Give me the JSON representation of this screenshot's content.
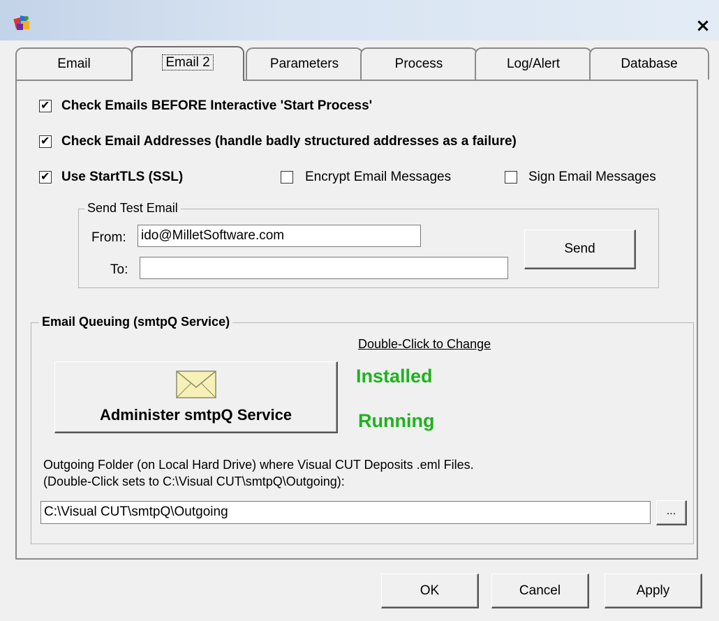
{
  "window": {
    "close_label": "×"
  },
  "tabs": [
    {
      "label": "Email"
    },
    {
      "label": "Email 2"
    },
    {
      "label": "Parameters"
    },
    {
      "label": "Process"
    },
    {
      "label": "Log/Alert"
    },
    {
      "label": "Database"
    }
  ],
  "active_tab": "Email 2",
  "options": {
    "check_before_start": {
      "label": "Check Emails BEFORE Interactive 'Start Process'",
      "checked": true
    },
    "check_addresses": {
      "label": "Check Email Addresses (handle badly structured addresses as a failure)",
      "checked": true
    },
    "use_starttls": {
      "label": "Use StartTLS (SSL)",
      "checked": true
    },
    "encrypt_messages": {
      "label": "Encrypt Email Messages",
      "checked": false
    },
    "sign_messages": {
      "label": "Sign Email Messages",
      "checked": false
    }
  },
  "test_email": {
    "group_title": "Send Test Email",
    "from_label": "From:",
    "from_value": "ido@MilletSoftware.com",
    "to_label": "To:",
    "to_value": "",
    "send_label": "Send"
  },
  "queuing": {
    "group_title": "Email Queuing (smtpQ Service)",
    "change_hint": "Double-Click to Change",
    "installed_status": "Installed",
    "running_status": "Running",
    "admin_button_label": "Administer smtpQ Service",
    "folder_line1": "Outgoing Folder (on Local Hard Drive) where Visual CUT Deposits .eml Files.",
    "folder_line2": "(Double-Click sets to C:\\Visual CUT\\smtpQ\\Outgoing):",
    "folder_value": "C:\\Visual CUT\\smtpQ\\Outgoing",
    "browse_label": "...",
    "status_color": "#1db31d"
  },
  "footer": {
    "ok_label": "OK",
    "cancel_label": "Cancel",
    "apply_label": "Apply"
  }
}
